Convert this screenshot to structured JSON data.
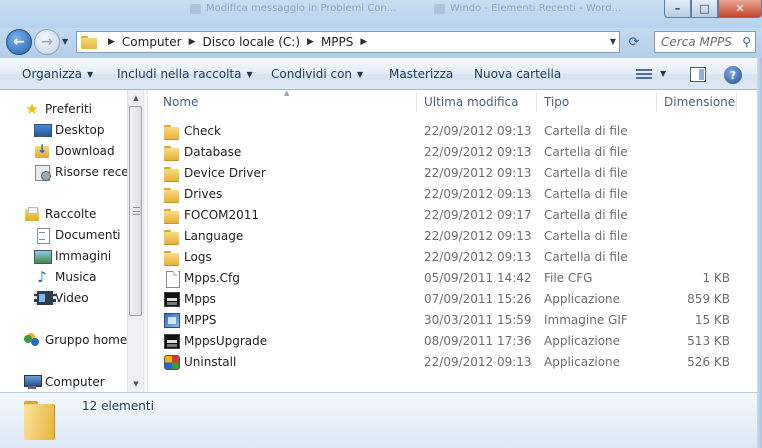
{
  "window": {
    "ghost_tabs": [
      "Modifica messaggio in Problemi Con...",
      "Windo - Elementi Recenti - Word..."
    ],
    "controls": {
      "minimize": "–",
      "maximize": "□",
      "close": "✕"
    }
  },
  "address": {
    "breadcrumbs": [
      "Computer",
      "Disco locale (C:)",
      "MPPS"
    ],
    "search_placeholder": "Cerca MPPS"
  },
  "commandbar": {
    "organize": "Organizza",
    "include_library": "Includi nella raccolta",
    "share_with": "Condividi con",
    "burn": "Masterizza",
    "new_folder": "Nuova cartella"
  },
  "navigation": {
    "favorites_header": "Preferiti",
    "favorites": [
      "Desktop",
      "Download",
      "Risorse recenti"
    ],
    "libraries_header": "Raccolte",
    "libraries": [
      "Documenti",
      "Immagini",
      "Musica",
      "Video"
    ],
    "homegroup": "Gruppo home",
    "computer": "Computer"
  },
  "columns": {
    "name": "Nome",
    "modified": "Ultima modifica",
    "type": "Tipo",
    "size": "Dimensione"
  },
  "files": [
    {
      "name": "Check",
      "modified": "22/09/2012 09:13",
      "type": "Cartella di file",
      "size": "",
      "icon": "folder-icon"
    },
    {
      "name": "Database",
      "modified": "22/09/2012 09:13",
      "type": "Cartella di file",
      "size": "",
      "icon": "folder-icon"
    },
    {
      "name": "Device Driver",
      "modified": "22/09/2012 09:13",
      "type": "Cartella di file",
      "size": "",
      "icon": "folder-icon"
    },
    {
      "name": "Drives",
      "modified": "22/09/2012 09:13",
      "type": "Cartella di file",
      "size": "",
      "icon": "folder-icon"
    },
    {
      "name": "FOCOM2011",
      "modified": "22/09/2012 09:17",
      "type": "Cartella di file",
      "size": "",
      "icon": "folder-icon"
    },
    {
      "name": "Language",
      "modified": "22/09/2012 09:13",
      "type": "Cartella di file",
      "size": "",
      "icon": "folder-icon"
    },
    {
      "name": "Logs",
      "modified": "22/09/2012 09:13",
      "type": "Cartella di file",
      "size": "",
      "icon": "folder-icon"
    },
    {
      "name": "Mpps.Cfg",
      "modified": "05/09/2011 14:42",
      "type": "File CFG",
      "size": "1 KB",
      "icon": "cfg-file-icon"
    },
    {
      "name": "Mpps",
      "modified": "07/09/2011 15:26",
      "type": "Applicazione",
      "size": "859 KB",
      "icon": "application-icon"
    },
    {
      "name": "MPPS",
      "modified": "30/03/2011 15:59",
      "type": "Immagine GIF",
      "size": "15 KB",
      "icon": "gif-image-icon"
    },
    {
      "name": "MppsUpgrade",
      "modified": "08/09/2011 17:36",
      "type": "Applicazione",
      "size": "513 KB",
      "icon": "application-icon"
    },
    {
      "name": "Uninstall",
      "modified": "22/09/2012 09:13",
      "type": "Applicazione",
      "size": "526 KB",
      "icon": "uninstall-icon"
    }
  ],
  "status": {
    "item_count": "12 elementi"
  }
}
